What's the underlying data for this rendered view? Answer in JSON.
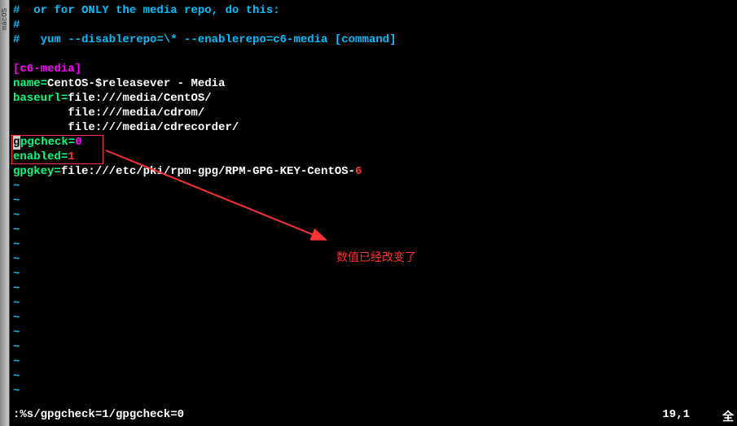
{
  "sidebar": {
    "label": "macOS"
  },
  "lines": {
    "c1": "#  or for ONLY the media repo, do this:",
    "c2": "#",
    "c3a": "#   yum --disablerepo=\\* --enablerepo=c6-media [command]",
    "section": "[c6-media]",
    "name_key": "name",
    "name_val": "CentOS-$releasever - Media",
    "baseurl_key": "baseurl",
    "baseurl_val1": "file:///media/CentOS/",
    "baseurl_val2": "        file:///media/cdrom/",
    "baseurl_val3": "        file:///media/cdrecorder/",
    "gpgcheck_key": "pgcheck",
    "gpgcheck_val": "0",
    "enabled_key": "enabled",
    "enabled_val": "1",
    "gpgkey_key": "gpgkey",
    "gpgkey_val_a": "file:///etc/pki/rpm-gpg/RPM-GPG-KEY-CentOS-",
    "gpgkey_val_b": "6",
    "tilde": "~"
  },
  "annotation": "数值已经改变了",
  "status": {
    "command": ":%s/gpgcheck=1/gpgcheck=0",
    "position": "19,1",
    "mode": "全"
  }
}
